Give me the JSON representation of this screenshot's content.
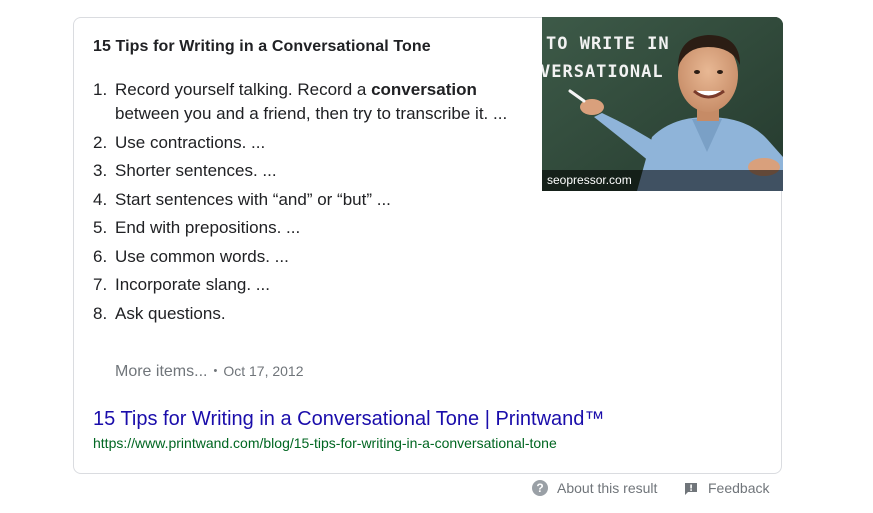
{
  "snippet": {
    "title": "15 Tips for Writing in a Conversational Tone",
    "tips": [
      {
        "num": "1.",
        "pre": "Record yourself talking. Record a ",
        "bold": "conversation",
        "post": " between you and a friend, then try to transcribe it. ..."
      },
      {
        "num": "2.",
        "pre": "Use contractions. ...",
        "bold": "",
        "post": ""
      },
      {
        "num": "3.",
        "pre": "Shorter sentences. ...",
        "bold": "",
        "post": ""
      },
      {
        "num": "4.",
        "pre": "Start sentences with “and” or “but” ...",
        "bold": "",
        "post": ""
      },
      {
        "num": "5.",
        "pre": "End with prepositions. ...",
        "bold": "",
        "post": ""
      },
      {
        "num": "6.",
        "pre": "Use common words. ...",
        "bold": "",
        "post": ""
      },
      {
        "num": "7.",
        "pre": "Incorporate slang. ...",
        "bold": "",
        "post": ""
      },
      {
        "num": "8.",
        "pre": "Ask questions.",
        "bold": "",
        "post": ""
      }
    ],
    "more_items": "More items...",
    "separator": "•",
    "date": "Oct 17, 2012",
    "image": {
      "board_text_line1": "TO WRITE IN",
      "board_text_line2": "VERSATIONAL",
      "caption": "seopressor.com"
    },
    "result_link": "15 Tips for Writing in a Conversational Tone | Printwand™",
    "result_url": "https://www.printwand.com/blog/15-tips-for-writing-in-a-conversational-tone"
  },
  "footer": {
    "about_label": "About this result",
    "about_icon": "question-circle-icon",
    "feedback_label": "Feedback",
    "feedback_icon": "feedback-icon"
  },
  "colors": {
    "link": "#1a0dab",
    "url": "#006621",
    "muted": "#70757a",
    "border": "#dadce0"
  }
}
